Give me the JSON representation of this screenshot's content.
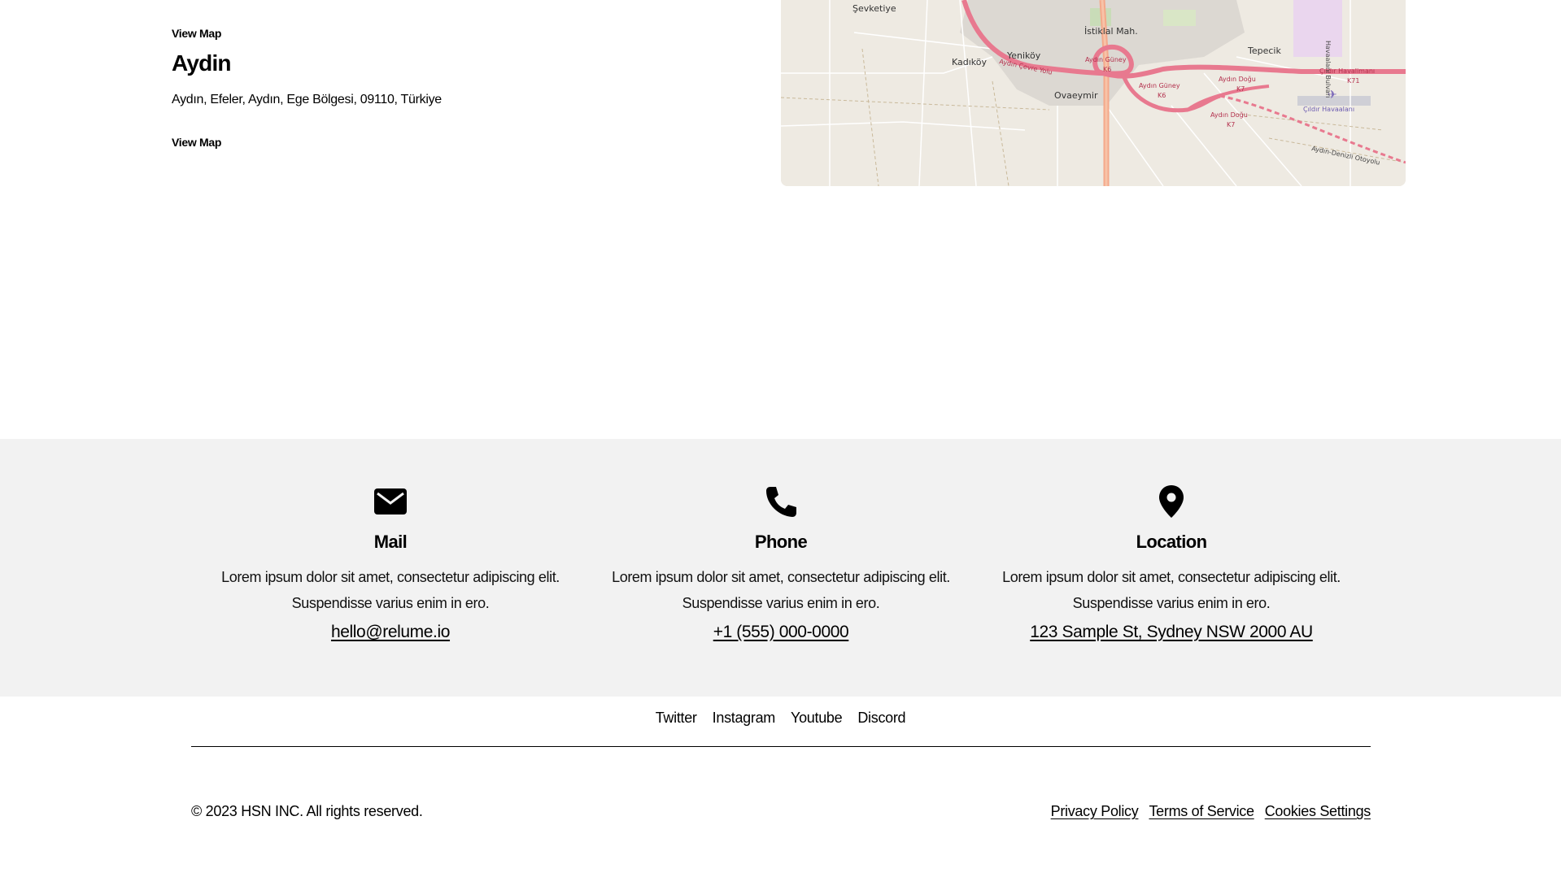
{
  "locations": {
    "prev_view_map": "View Map",
    "city": "Aydin",
    "address": "Aydın, Efeler, Aydın, Ege Bölgesi, 09110, Türkiye",
    "view_map": "View Map"
  },
  "map": {
    "labels": [
      "Şevketiye",
      "İstiklal Mah.",
      "Tepecik",
      "Kadıköy",
      "Yeniköy",
      "Ovaeymir",
      "Aydın Çevre Yolu",
      "Aydın Güney",
      "K6",
      "Aydın Güney",
      "K6",
      "Aydın Doğu",
      "K7",
      "Aydın Doğu",
      "K7",
      "Çıldır Havalimanı",
      "K71",
      "Çıldır Havaalanı",
      "Aydın-Denizli Otoyolu",
      "Havaalanı Bulvarı"
    ]
  },
  "contact": {
    "mail": {
      "icon": "envelope-icon",
      "title": "Mail",
      "text": "Lorem ipsum dolor sit amet, consectetur adipiscing elit. Suspendisse varius enim in ero.",
      "link": "hello@relume.io"
    },
    "phone": {
      "icon": "phone-icon",
      "title": "Phone",
      "text": "Lorem ipsum dolor sit amet, consectetur adipiscing elit. Suspendisse varius enim in ero.",
      "link": "+1 (555) 000-0000"
    },
    "location": {
      "icon": "map-pin-icon",
      "title": "Location",
      "text": "Lorem ipsum dolor sit amet, consectetur adipiscing elit. Suspendisse varius enim in ero.",
      "link": "123 Sample St, Sydney NSW 2000 AU"
    }
  },
  "footer": {
    "social": [
      "Twitter",
      "Instagram",
      "Youtube",
      "Discord"
    ],
    "copyright": "© 2023 HSN INC. All rights reserved.",
    "legal": [
      "Privacy Policy",
      "Terms of Service",
      "Cookies Settings"
    ]
  },
  "colors": {
    "band_bg": "#f2f2f2",
    "map_bg": "#eeeae2",
    "map_road": "#e8798f"
  }
}
